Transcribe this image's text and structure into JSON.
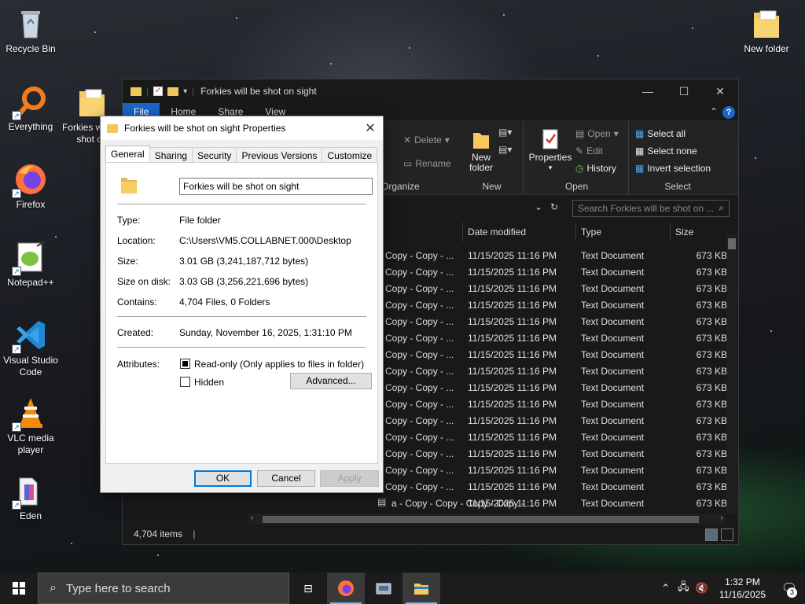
{
  "desktop": {
    "icons": [
      {
        "label": "Recycle Bin",
        "icon": "recycle-bin-icon"
      },
      {
        "label": "Everything",
        "icon": "everything-search-icon"
      },
      {
        "label": "Firefox",
        "icon": "firefox-icon"
      },
      {
        "label": "Notepad++",
        "icon": "notepad-plus-plus-icon"
      },
      {
        "label": "Visual Studio Code",
        "icon": "vscode-icon"
      },
      {
        "label": "VLC media player",
        "icon": "vlc-icon"
      },
      {
        "label": "Eden",
        "icon": "eden-icon"
      },
      {
        "label": "Forkies will be shot on",
        "icon": "folder-icon"
      },
      {
        "label": "New folder",
        "icon": "folder-icon"
      }
    ]
  },
  "explorer": {
    "title": "Forkies will be shot on sight",
    "tabs": [
      "File",
      "Home",
      "Share",
      "View"
    ],
    "ribbon": {
      "organize": {
        "label": "Organize",
        "delete": "Delete",
        "rename": "Rename"
      },
      "new": {
        "label": "New",
        "new_folder": "New folder"
      },
      "open": {
        "label": "Open",
        "properties": "Properties",
        "open": "Open",
        "edit": "Edit",
        "history": "History"
      },
      "select": {
        "label": "Select",
        "select_all": "Select all",
        "select_none": "Select none",
        "invert_selection": "Invert selection"
      }
    },
    "search_placeholder": "Search Forkies will be shot on ...",
    "columns": [
      "Date modified",
      "Type",
      "Size"
    ],
    "file_name_partial": "Copy - Copy - ...",
    "last_file_name": "a - Copy - Copy - Copy - Copy - ...",
    "file_date": "11/15/2025 11:16 PM",
    "file_type": "Text Document",
    "file_size": "673 KB",
    "visible_rows": 16,
    "status": "4,704 items"
  },
  "properties": {
    "title": "Forkies will be shot on sight Properties",
    "tabs": [
      "General",
      "Sharing",
      "Security",
      "Previous Versions",
      "Customize"
    ],
    "name": "Forkies will be shot on sight",
    "type_label": "Type:",
    "type_value": "File folder",
    "location_label": "Location:",
    "location_value": "C:\\Users\\VM5.COLLABNET.000\\Desktop",
    "size_label": "Size:",
    "size_value": "3.01 GB (3,241,187,712 bytes)",
    "size_on_disk_label": "Size on disk:",
    "size_on_disk_value": "3.03 GB (3,256,221,696 bytes)",
    "contains_label": "Contains:",
    "contains_value": "4,704 Files, 0 Folders",
    "created_label": "Created:",
    "created_value": "Sunday, November 16, 2025, 1:31:10 PM",
    "attributes_label": "Attributes:",
    "readonly_label": "Read-only (Only applies to files in folder)",
    "hidden_label": "Hidden",
    "advanced_label": "Advanced...",
    "ok": "OK",
    "cancel": "Cancel",
    "apply": "Apply"
  },
  "taskbar": {
    "search_placeholder": "Type here to search",
    "time": "1:32 PM",
    "date": "11/16/2025",
    "notification_count": "3"
  }
}
